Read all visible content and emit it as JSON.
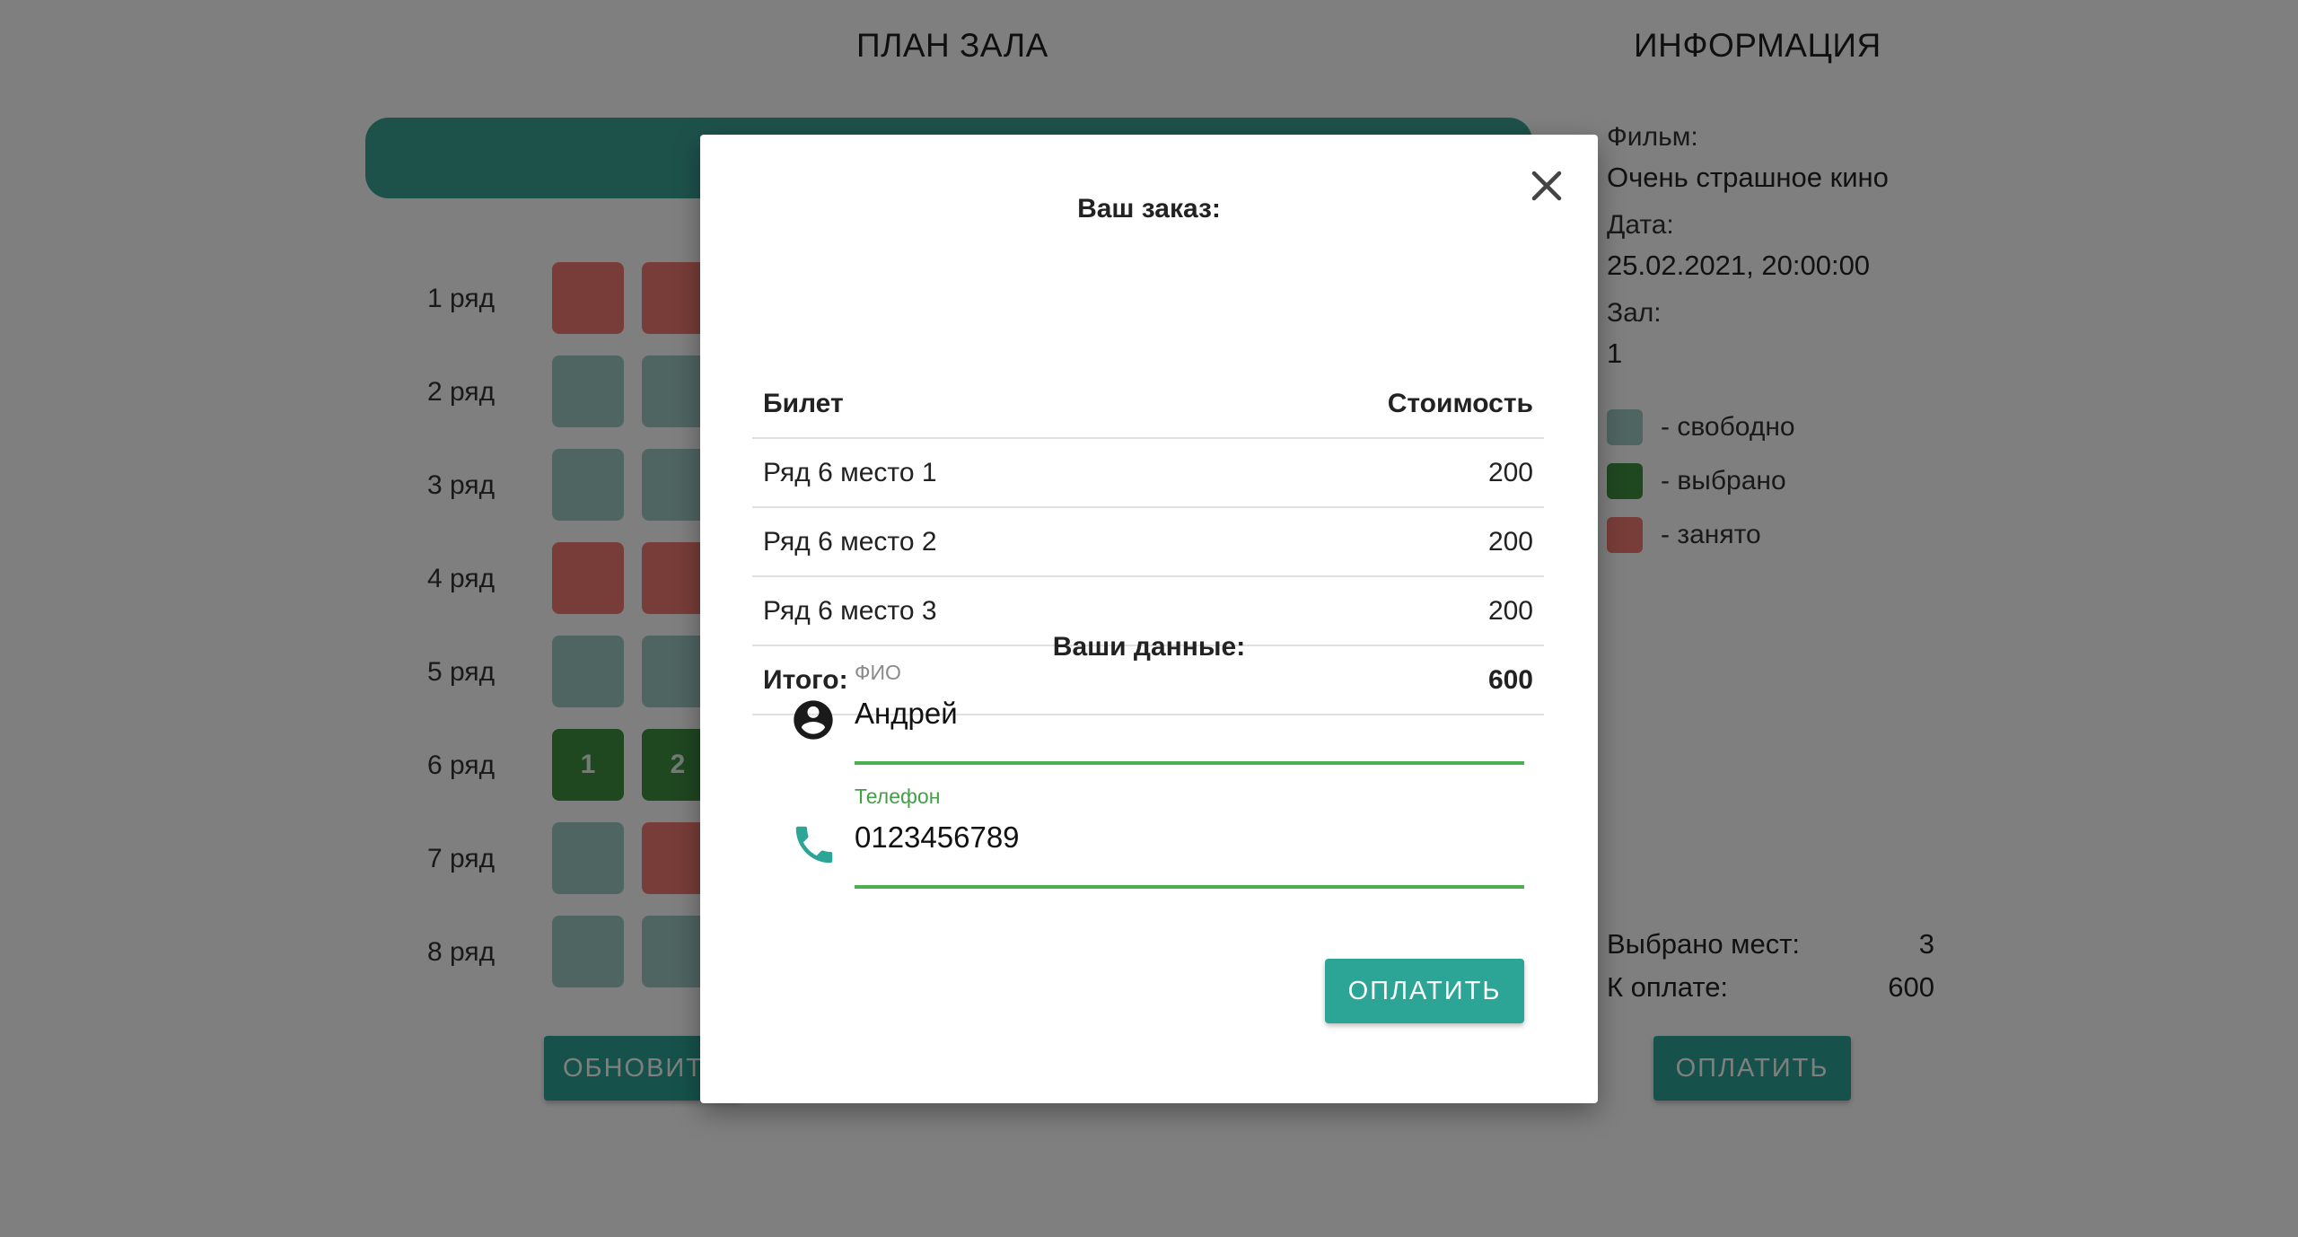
{
  "hall": {
    "title": "ПЛАН ЗАЛА",
    "rows": [
      {
        "label": "1 ряд",
        "seats": [
          {
            "status": "busy",
            "text": ""
          },
          {
            "status": "busy",
            "text": ""
          }
        ]
      },
      {
        "label": "2 ряд",
        "seats": [
          {
            "status": "free",
            "text": ""
          },
          {
            "status": "free",
            "text": ""
          }
        ]
      },
      {
        "label": "3 ряд",
        "seats": [
          {
            "status": "free",
            "text": ""
          },
          {
            "status": "free",
            "text": ""
          }
        ]
      },
      {
        "label": "4 ряд",
        "seats": [
          {
            "status": "busy",
            "text": ""
          },
          {
            "status": "busy",
            "text": ""
          }
        ]
      },
      {
        "label": "5 ряд",
        "seats": [
          {
            "status": "free",
            "text": ""
          },
          {
            "status": "free",
            "text": ""
          }
        ]
      },
      {
        "label": "6 ряд",
        "seats": [
          {
            "status": "selected",
            "text": "1"
          },
          {
            "status": "selected",
            "text": "2"
          }
        ]
      },
      {
        "label": "7 ряд",
        "seats": [
          {
            "status": "free",
            "text": ""
          },
          {
            "status": "busy",
            "text": ""
          }
        ]
      },
      {
        "label": "8 ряд",
        "seats": [
          {
            "status": "free",
            "text": ""
          },
          {
            "status": "free",
            "text": ""
          }
        ]
      }
    ],
    "refresh_label": "ОБНОВИТЬ"
  },
  "info": {
    "title": "ИНФОРМАЦИЯ",
    "film_label": "Фильм:",
    "film_value": "Очень страшное кино",
    "date_label": "Дата:",
    "date_value": "25.02.2021, 20:00:00",
    "hall_label": "Зал:",
    "hall_value": "1",
    "legend": [
      {
        "color": "#9ecbc5",
        "text": "- свободно"
      },
      {
        "color": "#3f8f41",
        "text": "- выбрано"
      },
      {
        "color": "#f07a72",
        "text": "- занято"
      }
    ],
    "selected_label": "Выбрано мест:",
    "selected_value": "3",
    "pay_label": "К оплате:",
    "pay_value": "600",
    "pay_button": "ОПЛАТИТЬ"
  },
  "modal": {
    "title": "Ваш заказ:",
    "col_ticket": "Билет",
    "col_price": "Стоимость",
    "tickets": [
      {
        "name": "Ряд 6 место 1",
        "price": "200"
      },
      {
        "name": "Ряд 6 место 2",
        "price": "200"
      },
      {
        "name": "Ряд 6 место 3",
        "price": "200"
      }
    ],
    "total_label": "Итого:",
    "total_value": "600",
    "data_title": "Ваши данные:",
    "name_label": "ФИО",
    "name_value": "Андрей",
    "phone_label": "Телефон",
    "phone_value": "0123456789",
    "pay_button": "ОПЛАТИТЬ"
  },
  "colors": {
    "accent": "#2da596",
    "free": "#9ecbc5",
    "selected": "#3f8f41",
    "busy": "#f07a72",
    "input_active": "#4caf50"
  },
  "icons": {
    "close": "close-icon",
    "person": "account-circle-icon",
    "phone": "phone-icon"
  }
}
